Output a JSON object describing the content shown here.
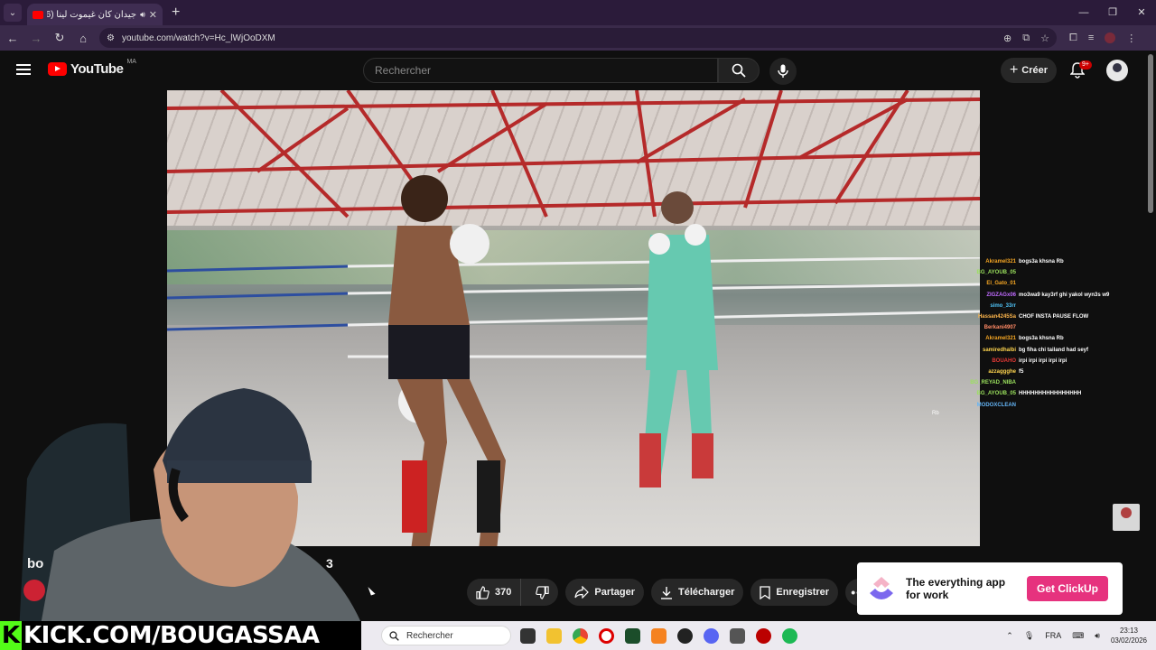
{
  "browser": {
    "tab_title": "جيدان كان غيموت لينا (46)",
    "new_tab": "+",
    "url": "youtube.com/watch?v=Hc_lWjOoDXM",
    "window_controls": [
      "—",
      "❐",
      "✕"
    ]
  },
  "youtube": {
    "logo": "YouTube",
    "country": "MA",
    "search_placeholder": "Rechercher",
    "create_label": "Créer",
    "notification_count": "9+"
  },
  "video": {
    "overlay_text": "Rb",
    "title_fragment": "bo",
    "title_suffix": "3"
  },
  "chat": [
    {
      "user": "Akramel321",
      "msg": "bogs3a khsna Rb",
      "color": "#f5a623"
    },
    {
      "user": "BG_AYOUB_05",
      "msg": "",
      "color": "#9be15d"
    },
    {
      "user": "El_Gato_01",
      "msg": "",
      "color": "#f5a623"
    },
    {
      "user": "ZIGZAGx06",
      "msg": "mo3wa9 kay3rf ghi yakol wyn3s w9",
      "color": "#c06bff"
    },
    {
      "user": "simo_33rr",
      "msg": "",
      "color": "#4fc3f7"
    },
    {
      "user": "Hassan4245Sa",
      "msg": "CHOF INSTA PAUSE FLOW",
      "color": "#ffb74d"
    },
    {
      "user": "Berkani4907",
      "msg": "",
      "color": "#ff8a65"
    },
    {
      "user": "Akramel321",
      "msg": "bogs3a khsna Rb",
      "color": "#f5a623"
    },
    {
      "user": "samiredhalbi",
      "msg": "bg fiha chi tailand had seyf",
      "color": "#ffd54f"
    },
    {
      "user": "BOUAHO",
      "msg": "irpi irpi irpi irpi irpi",
      "color": "#e53935"
    },
    {
      "user": "azzaggghe",
      "msg": "f5",
      "color": "#ffd54f"
    },
    {
      "user": "BG_REYAD_NIBA",
      "msg": "",
      "color": "#9be15d"
    },
    {
      "user": "BG_AYOUB_05",
      "msg": "HHHHHHHHHHHHHHHH",
      "color": "#9be15d"
    },
    {
      "user": "MODOXCLEAN",
      "msg": "",
      "color": "#64b5f6"
    }
  ],
  "actions": {
    "likes": "370",
    "share": "Partager",
    "download": "Télécharger",
    "save": "Enregistrer"
  },
  "ad": {
    "text": "The everything app for work",
    "cta": "Get ClickUp"
  },
  "stream_banner": {
    "k": "K",
    "text": "KICK.COM/BOUGASSAA"
  },
  "taskbar": {
    "search": "Rechercher",
    "lang": "FRA",
    "time": "23:13",
    "date": "03/02/2026"
  }
}
